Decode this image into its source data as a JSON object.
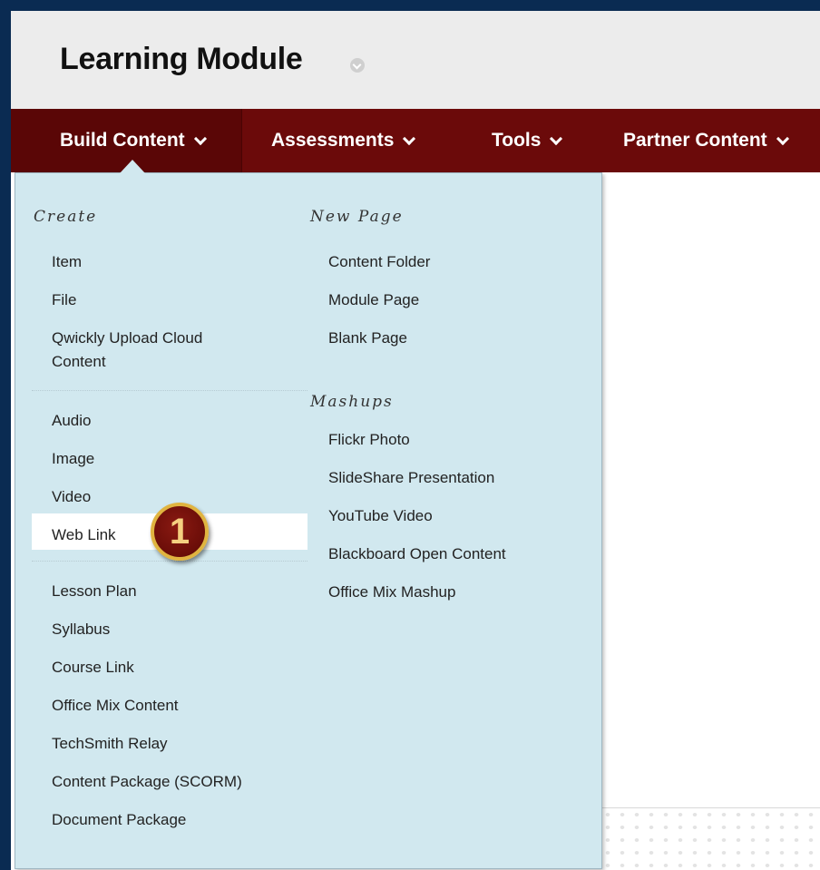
{
  "header": {
    "title": "Learning Module"
  },
  "menu": {
    "items": [
      {
        "label": "Build Content"
      },
      {
        "label": "Assessments"
      },
      {
        "label": "Tools"
      },
      {
        "label": "Partner Content"
      }
    ]
  },
  "dropdown": {
    "create": {
      "heading": "Create",
      "group1": [
        "Item",
        "File",
        "Qwickly Upload Cloud",
        "Content"
      ],
      "group2": [
        "Audio",
        "Image",
        "Video",
        "Web Link"
      ],
      "group3": [
        "Lesson Plan",
        "Syllabus",
        "Course Link",
        "Office Mix Content",
        "TechSmith Relay",
        "Content Package (SCORM)",
        "Document Package"
      ]
    },
    "new_page": {
      "heading": "New Page",
      "items": [
        "Content Folder",
        "Module Page",
        "Blank Page"
      ]
    },
    "mashups": {
      "heading": "Mashups",
      "items": [
        "Flickr Photo",
        "SlideShare Presentation",
        "YouTube Video",
        "Blackboard Open Content",
        "Office Mix Mashup"
      ]
    }
  },
  "callout": {
    "number": "1",
    "color": "#6a0d08",
    "ring_color": "#e0b440"
  },
  "colors": {
    "menu_bar": "#6b0a0a",
    "dropdown_bg": "#d1e8ef",
    "border": "#0a2b52"
  },
  "icons": {
    "title_menu": "chevron-down-circle-icon",
    "menu_chevrons": "chevron-down-icon"
  }
}
